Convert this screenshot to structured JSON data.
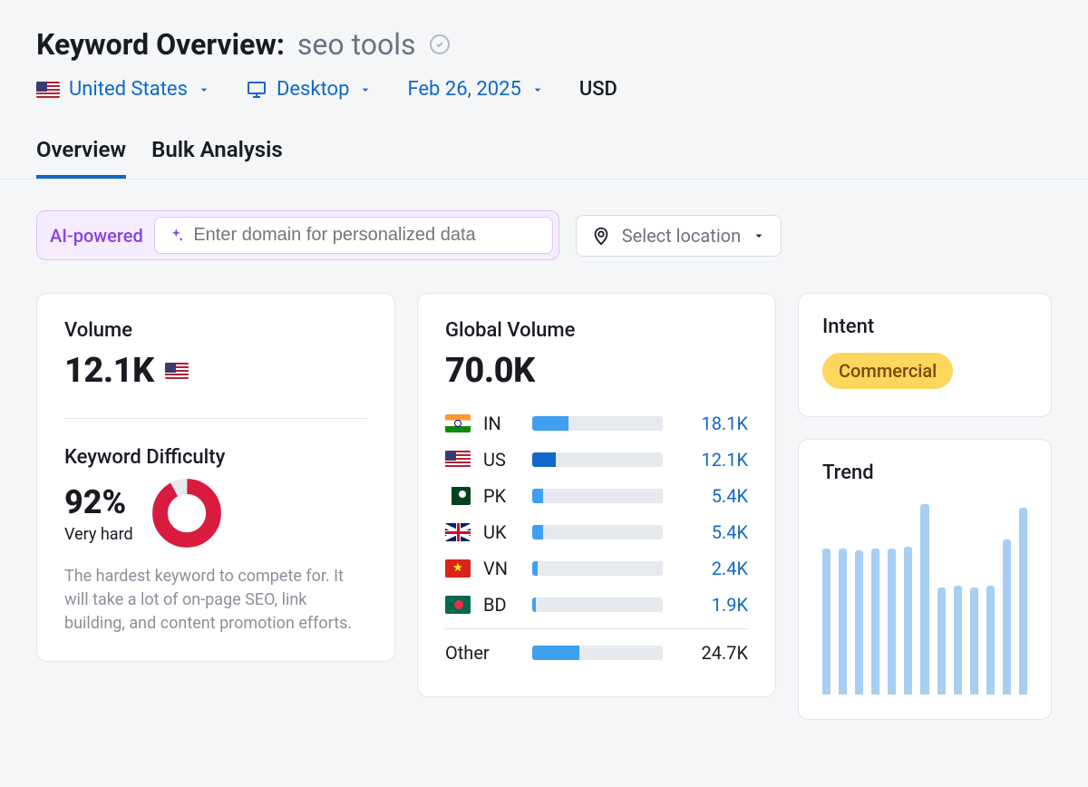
{
  "header": {
    "title_label": "Keyword Overview:",
    "query": "seo tools"
  },
  "selectors": {
    "country": "United States",
    "device": "Desktop",
    "date": "Feb 26, 2025",
    "currency": "USD"
  },
  "tabs": [
    {
      "label": "Overview",
      "active": true
    },
    {
      "label": "Bulk Analysis",
      "active": false
    }
  ],
  "filters": {
    "ai_label": "AI-powered",
    "domain_placeholder": "Enter domain for personalized data",
    "location_label": "Select location"
  },
  "volume": {
    "title": "Volume",
    "value": "12.1K",
    "flag": "us"
  },
  "keyword_difficulty": {
    "title": "Keyword Difficulty",
    "percent": "92%",
    "numeric": 92,
    "label": "Very hard",
    "description": "The hardest keyword to compete for. It will take a lot of on-page SEO, link building, and content promotion efforts."
  },
  "global_volume": {
    "title": "Global Volume",
    "total": "70.0K",
    "rows": [
      {
        "cc": "IN",
        "flag": "in",
        "value": "18.1K",
        "pct": 28
      },
      {
        "cc": "US",
        "flag": "us",
        "value": "12.1K",
        "pct": 18
      },
      {
        "cc": "PK",
        "flag": "pk",
        "value": "5.4K",
        "pct": 8
      },
      {
        "cc": "UK",
        "flag": "uk",
        "value": "5.4K",
        "pct": 8
      },
      {
        "cc": "VN",
        "flag": "vn",
        "value": "2.4K",
        "pct": 4
      },
      {
        "cc": "BD",
        "flag": "bd",
        "value": "1.9K",
        "pct": 3
      }
    ],
    "other_label": "Other",
    "other_value": "24.7K",
    "other_pct": 36
  },
  "intent": {
    "title": "Intent",
    "badge": "Commercial"
  },
  "trend": {
    "title": "Trend"
  },
  "chart_data": {
    "type": "bar",
    "title": "Trend",
    "xlabel": "",
    "ylabel": "",
    "ylim": [
      0,
      100
    ],
    "categories": [
      "1",
      "2",
      "3",
      "4",
      "5",
      "6",
      "7",
      "8",
      "9",
      "10",
      "11",
      "12",
      "13"
    ],
    "values": [
      75,
      75,
      74,
      75,
      75,
      76,
      98,
      55,
      56,
      55,
      56,
      80,
      96
    ]
  }
}
